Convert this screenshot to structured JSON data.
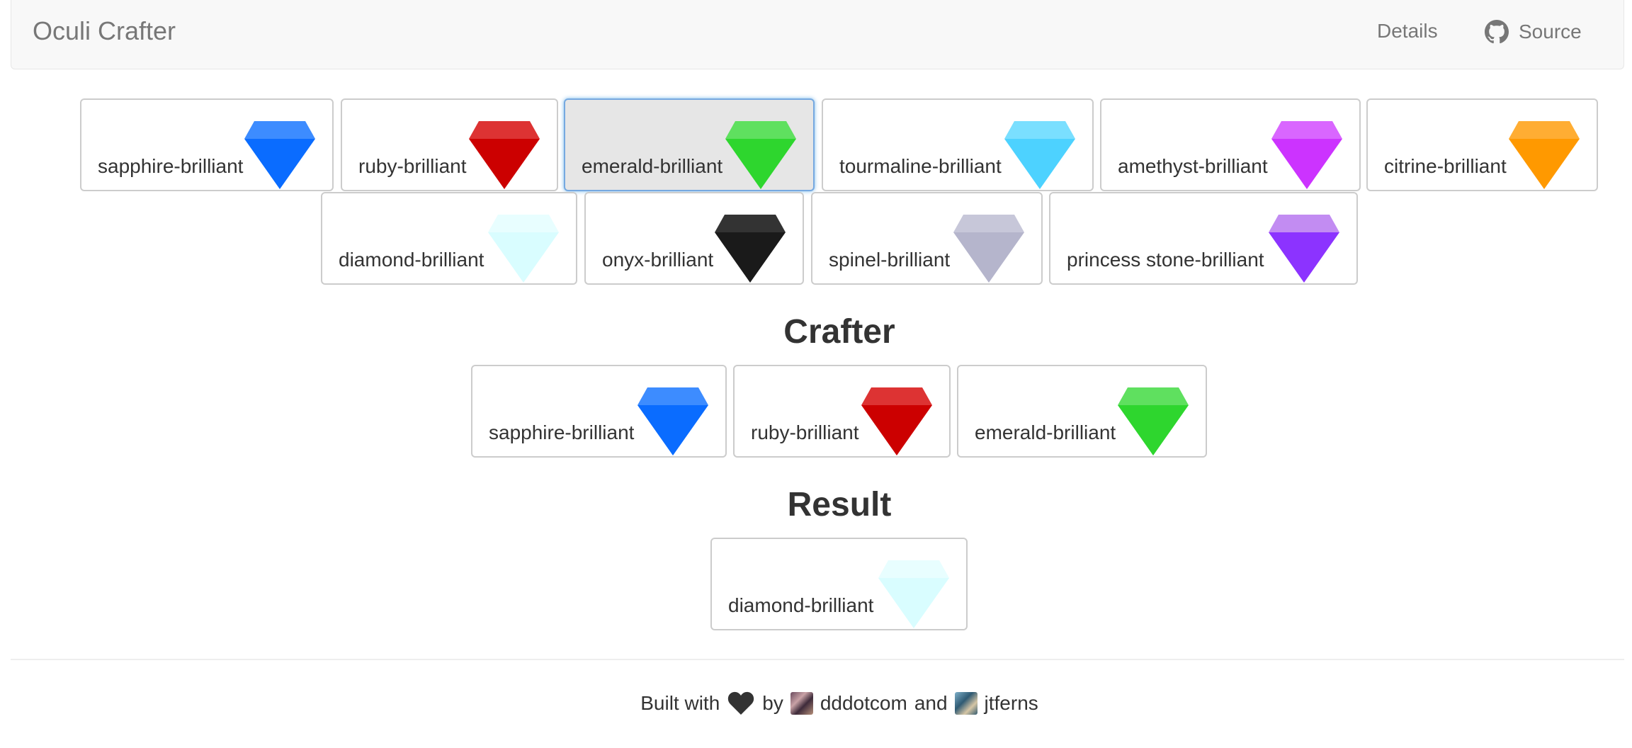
{
  "navbar": {
    "brand": "Oculi Crafter",
    "details_label": "Details",
    "source_label": "Source",
    "source_icon": "github-icon"
  },
  "inventory": [
    {
      "label": "sapphire-brilliant",
      "color": "#0a6cff",
      "light": "#3d8cff",
      "selected": false
    },
    {
      "label": "ruby-brilliant",
      "color": "#cc0000",
      "light": "#dd3333",
      "selected": false
    },
    {
      "label": "emerald-brilliant",
      "color": "#2ed62e",
      "light": "#5fe05f",
      "selected": true
    },
    {
      "label": "tourmaline-brilliant",
      "color": "#4dd2ff",
      "light": "#7adfff",
      "selected": false
    },
    {
      "label": "amethyst-brilliant",
      "color": "#cc33ff",
      "light": "#d966ff",
      "selected": false
    },
    {
      "label": "citrine-brilliant",
      "color": "#ff9900",
      "light": "#ffad33",
      "selected": false
    },
    {
      "label": "diamond-brilliant",
      "color": "#d9fdff",
      "light": "#e8feff",
      "selected": false
    },
    {
      "label": "onyx-brilliant",
      "color": "#1a1a1a",
      "light": "#333333",
      "selected": false
    },
    {
      "label": "spinel-brilliant",
      "color": "#b5b5cc",
      "light": "#c7c7d9",
      "selected": false
    },
    {
      "label": "princess stone-brilliant",
      "color": "#8c33ff",
      "light": "#c28cf2",
      "selected": false
    }
  ],
  "crafter": {
    "title": "Crafter",
    "items": [
      {
        "label": "sapphire-brilliant",
        "color": "#0a6cff",
        "light": "#3d8cff"
      },
      {
        "label": "ruby-brilliant",
        "color": "#cc0000",
        "light": "#dd3333"
      },
      {
        "label": "emerald-brilliant",
        "color": "#2ed62e",
        "light": "#5fe05f"
      }
    ]
  },
  "result": {
    "title": "Result",
    "items": [
      {
        "label": "diamond-brilliant",
        "color": "#d9fdff",
        "light": "#e8feff"
      }
    ]
  },
  "footer": {
    "built_with": "Built with",
    "by": "by",
    "author1": "dddotcom",
    "and": "and",
    "author2": "jtferns"
  }
}
